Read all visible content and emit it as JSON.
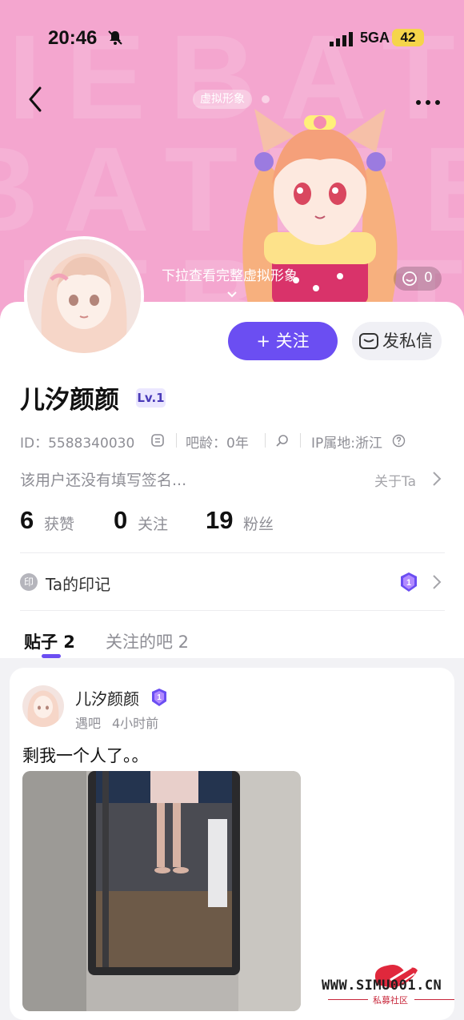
{
  "status_bar": {
    "time": "20:46",
    "network": "5GA",
    "battery": "42"
  },
  "header": {
    "avatar_tag": "虚拟形象",
    "pull_hint": "下拉查看完整虚拟形象",
    "like_count": "0"
  },
  "actions": {
    "follow": "+ 关注",
    "message": "发私信"
  },
  "profile": {
    "name": "儿汐颜颜",
    "level": "Lv.1",
    "id_text": "ID：5588340030",
    "bar_age": "吧龄：0年",
    "ip": "IP属地:浙江",
    "signature": "该用户还没有填写签名...",
    "about_link": "关于Ta"
  },
  "stats": [
    {
      "num": "6",
      "label": "获赞"
    },
    {
      "num": "0",
      "label": "关注"
    },
    {
      "num": "19",
      "label": "粉丝"
    }
  ],
  "seal": {
    "icon": "印",
    "label": "Ta的印记"
  },
  "tabs": [
    {
      "label": "贴子 2",
      "active": true
    },
    {
      "label": "关注的吧 2",
      "active": false
    }
  ],
  "post": {
    "author": "儿汐颜颜",
    "forum": "遇吧",
    "time": "4小时前",
    "text": "剩我一个人了。。"
  },
  "watermark": {
    "site": "WWW.SIMU001.CN",
    "sub": "私募社区"
  },
  "colors": {
    "accent": "#6b4ef2",
    "hero": "#f4a6cf"
  }
}
